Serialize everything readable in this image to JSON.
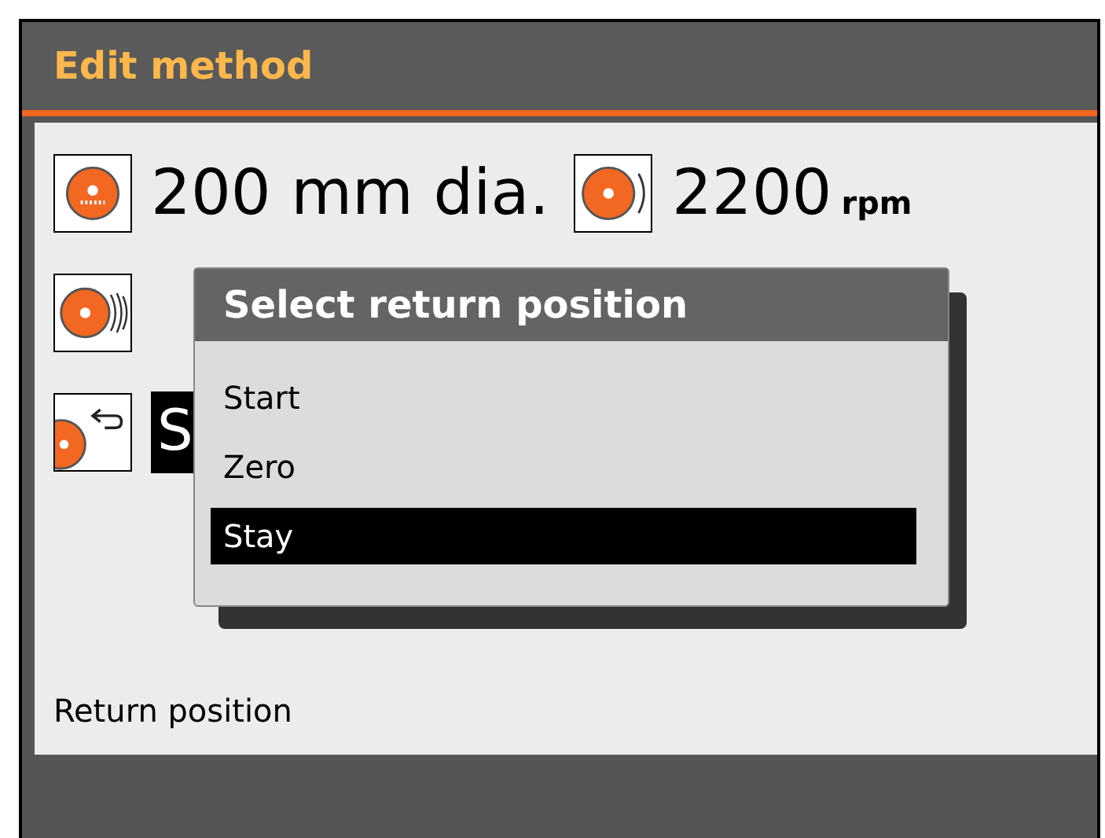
{
  "window": {
    "title": "Edit method"
  },
  "settings": [
    {
      "kind": "diameter",
      "value": "200 mm dia.",
      "speed": "2200",
      "unit": "rpm"
    },
    {
      "kind": "feed"
    },
    {
      "kind": "return",
      "value": "S"
    }
  ],
  "status": "Return position",
  "popup": {
    "title": "Select return position",
    "options": [
      {
        "label": "Start",
        "selected": false
      },
      {
        "label": "Zero",
        "selected": false
      },
      {
        "label": "Stay",
        "selected": true
      }
    ]
  }
}
